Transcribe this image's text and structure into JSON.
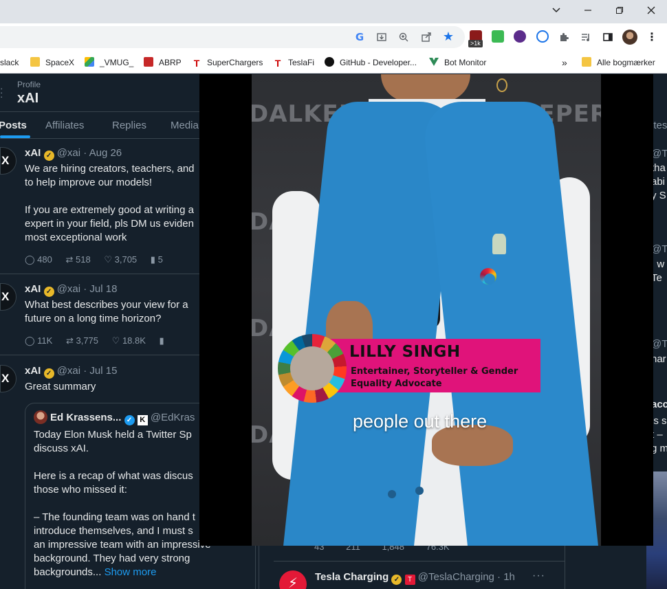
{
  "window_controls": {
    "dropdown": "⌄",
    "minimize": "—",
    "restore": "❐",
    "close": "✕"
  },
  "toolbar": {
    "icons": [
      "google-lens-icon",
      "install-icon",
      "zoom-icon",
      "share-icon",
      "bookmark-star-icon"
    ],
    "extension_badge": ">1k",
    "accent": "#1a73e8"
  },
  "bookmarks": [
    {
      "label": "slack",
      "icon": "folder-icon",
      "color": "#f4c542"
    },
    {
      "label": "SpaceX",
      "icon": "folder-icon",
      "color": "#f4c542"
    },
    {
      "label": "_VMUG_",
      "icon": "google-drive-icon",
      "color": "#34a853"
    },
    {
      "label": "ABRP",
      "icon": "abrp-icon",
      "color": "#c62828"
    },
    {
      "label": "SuperChargers",
      "icon": "tesla-icon",
      "color": "#cc0000"
    },
    {
      "label": "TeslaFi",
      "icon": "teslafi-icon",
      "color": "#333333"
    },
    {
      "label": "GitHub - Developer...",
      "icon": "github-icon",
      "color": "#111111"
    },
    {
      "label": "Bot Monitor",
      "icon": "vue-icon",
      "color": "#2e8b57"
    }
  ],
  "bookmarks_overflow": "»",
  "all_bookmarks": "Alle bogmærker",
  "profile": {
    "label": "Profile",
    "name": "xAI",
    "tabs": [
      "Posts",
      "Affiliates",
      "Replies",
      "Media"
    ]
  },
  "tweets": [
    {
      "name": "xAI",
      "meta": "@xai · Aug 26",
      "lines": [
        "We are hiring creators, teachers, and",
        "to help improve our models!",
        "",
        "If you are extremely good at writing a",
        "expert in your field, pls DM us eviden",
        "most exceptional work"
      ],
      "stats": {
        "replies": "480",
        "reposts": "518",
        "likes": "3,705",
        "views": "5"
      }
    },
    {
      "name": "xAI",
      "meta": "@xai · Jul 18",
      "lines": [
        "What best describes your view for a",
        "future on a long time horizon?"
      ],
      "stats": {
        "replies": "11K",
        "reposts": "3,775",
        "likes": "18.8K",
        "views": ""
      }
    },
    {
      "name": "xAI",
      "meta": "@xai · Jul 15",
      "lines": [
        "Great summary"
      ],
      "quote": {
        "name": "Ed Krassens...",
        "handle": "@EdKras",
        "lines": [
          "Today Elon Musk held a Twitter Sp",
          "discuss xAI.",
          "",
          "Here is a recap of what was discus",
          "those who missed it:",
          "",
          "– The founding team was on hand t",
          "introduce themselves, and I must s",
          "an impressive team with an impressive",
          "background. They had very strong",
          "backgrounds..."
        ],
        "show_more": "Show more"
      }
    }
  ],
  "right_column_fragments": [
    "ites",
    "@Te",
    "tha",
    "abi",
    "y S",
    "@Te",
    ", w",
    "Te",
    "@Te",
    "har",
    "acc",
    "is s",
    "t –",
    "g m"
  ],
  "video": {
    "backdrop": [
      "DALKEEPERS2030",
      "ALKEEPERS",
      "DALKE",
      "DALKEEPERS",
      "DALKE"
    ],
    "lower_third": {
      "name": "LILLY SINGH",
      "title_line1": "Entertainer, Storyteller & Gender",
      "title_line2": "Equality Advocate"
    },
    "caption": "people out there",
    "accent": "#e0137a"
  },
  "bottom_tweet": {
    "stats": [
      "43",
      "211",
      "1,848",
      "76.3K"
    ],
    "name": "Tesla Charging",
    "handle": "@TeslaCharging · 1h",
    "more": "···"
  }
}
